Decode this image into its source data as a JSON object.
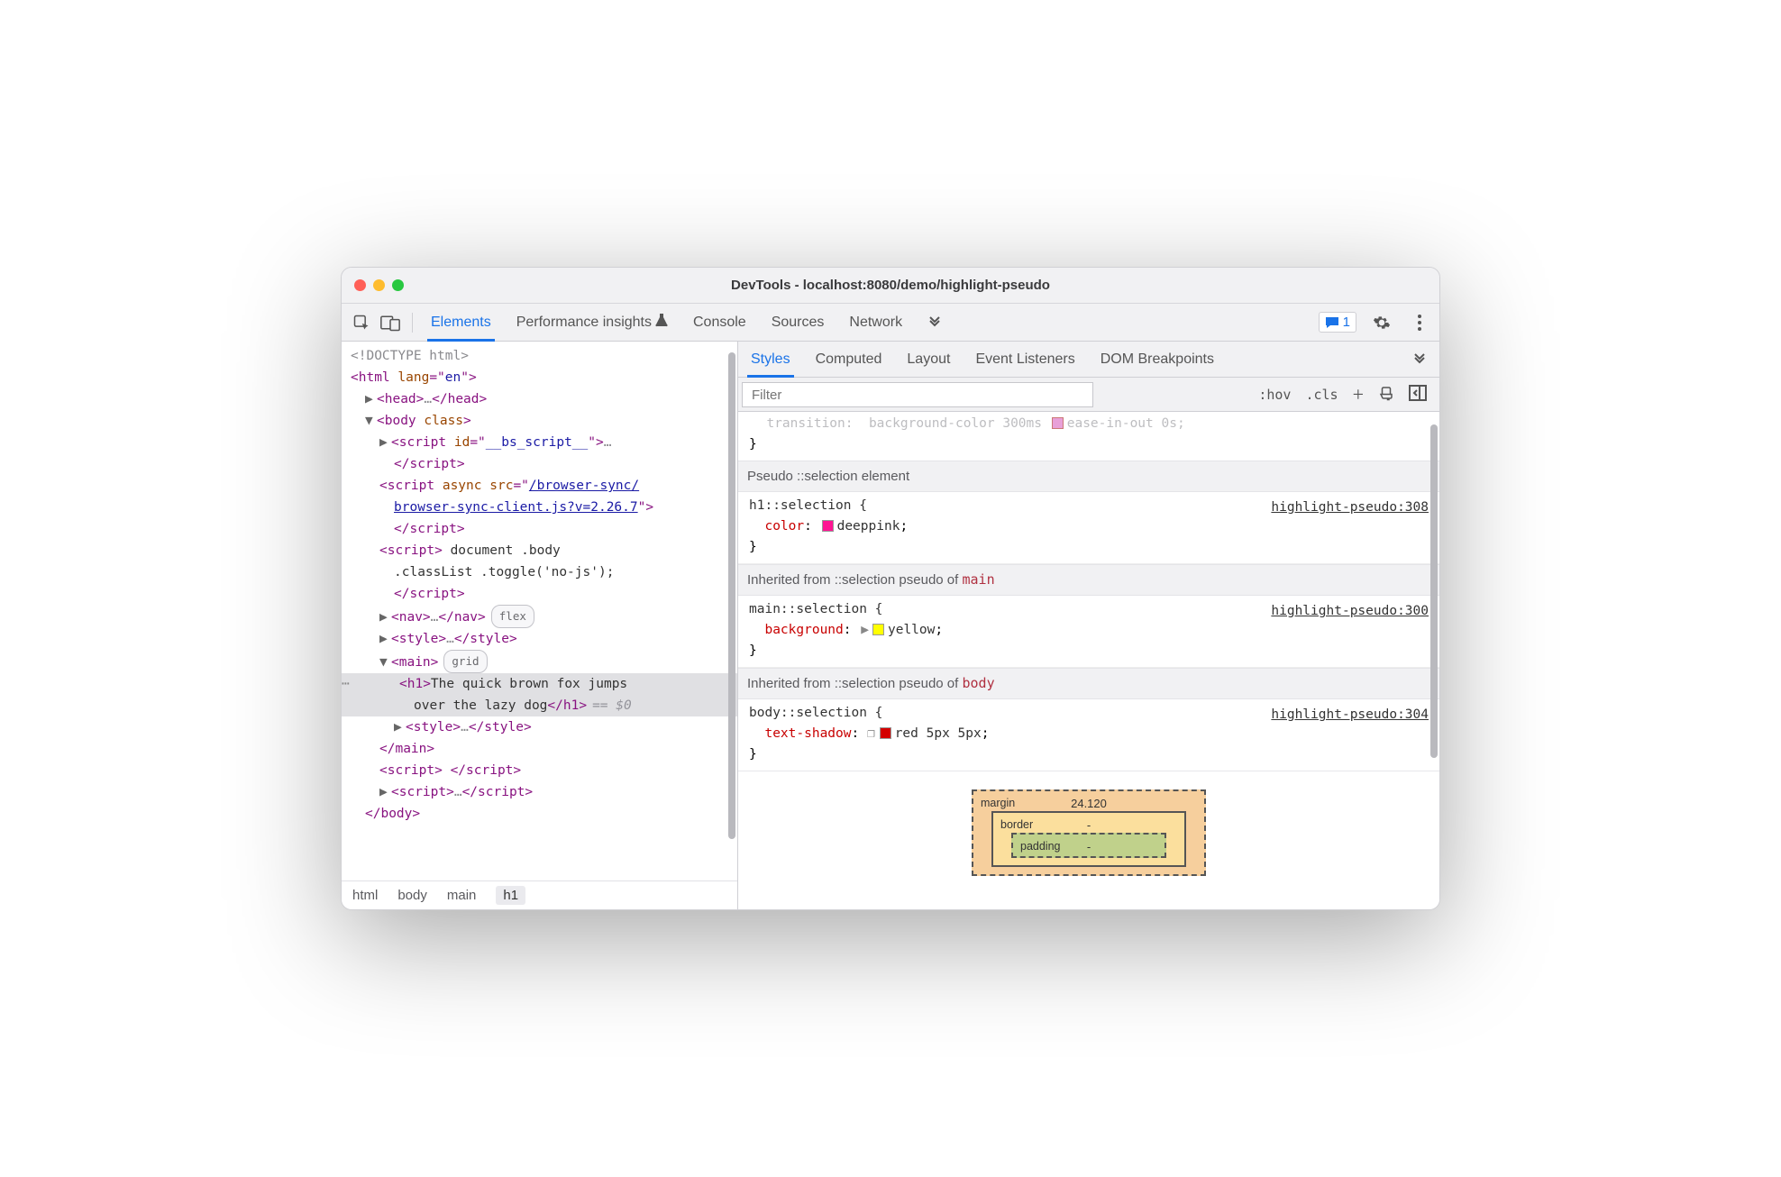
{
  "window": {
    "title": "DevTools - localhost:8080/demo/highlight-pseudo"
  },
  "main_tabs": {
    "elements": "Elements",
    "perf": "Performance insights",
    "console": "Console",
    "sources": "Sources",
    "network": "Network"
  },
  "issues_count": "1",
  "dom": {
    "doctype": "<!DOCTYPE html>",
    "html_open": "<html lang=\"en\">",
    "head": "<head>…</head>",
    "body_open": "<body class>",
    "bs_script": "<script id=\"__bs_script__\">…",
    "bs_script_close": "</script>",
    "async_open": "<script async src=\"",
    "async_url_line1": "/browser-sync/",
    "async_url_line2": "browser-sync-client.js?v=2.26.7",
    "async_open_tail": "\">",
    "async_close": "</script>",
    "inline_script_open": "<script>",
    "inline_script_body1": " document .body",
    "inline_script_body2": ".classList .toggle('no-js');",
    "inline_script_close": "</script>",
    "nav": "<nav>…</nav>",
    "nav_badge": "flex",
    "style_top": "<style>…</style>",
    "main_open": "<main>",
    "main_badge": "grid",
    "h1_text": "The quick brown fox jumps over the lazy dog",
    "h1_open": "<h1>",
    "h1_close": "</h1>",
    "eq0": "== $0",
    "style_in_main": "<style>…</style>",
    "main_close": "</main>",
    "empty_script": "<script> </script>",
    "last_script": "<script>…</script>",
    "body_close": "</body>"
  },
  "breadcrumbs": [
    "html",
    "body",
    "main",
    "h1"
  ],
  "right_tabs": {
    "styles": "Styles",
    "computed": "Computed",
    "layout": "Layout",
    "events": "Event Listeners",
    "domb": "DOM Breakpoints"
  },
  "styles_toolbar": {
    "filter_placeholder": "Filter",
    "hov": ":hov",
    "cls": ".cls"
  },
  "rules": {
    "group1": "Pseudo ::selection element",
    "r1_sel": "h1::selection {",
    "r1_prop": "color",
    "r1_val": "deeppink",
    "r1_loc": "highlight-pseudo:308",
    "group2_a": "Inherited from ::selection pseudo of ",
    "group2_b": "main",
    "r2_sel": "main::selection {",
    "r2_prop": "background",
    "r2_val": "yellow",
    "r2_loc": "highlight-pseudo:300",
    "group3_a": "Inherited from ::selection pseudo of ",
    "group3_b": "body",
    "r3_sel": "body::selection {",
    "r3_prop": "text-shadow",
    "r3_val": "red 5px 5px",
    "r3_loc": "highlight-pseudo:304",
    "brace_close": "}"
  },
  "boxmodel": {
    "margin_label": "margin",
    "margin_top": "24.120",
    "border_label": "border",
    "border_top": "-",
    "padding_label": "padding",
    "padding_top": "-"
  },
  "colors": {
    "deeppink": "#ff1493",
    "yellow": "#ffff00",
    "red": "#d40000"
  }
}
